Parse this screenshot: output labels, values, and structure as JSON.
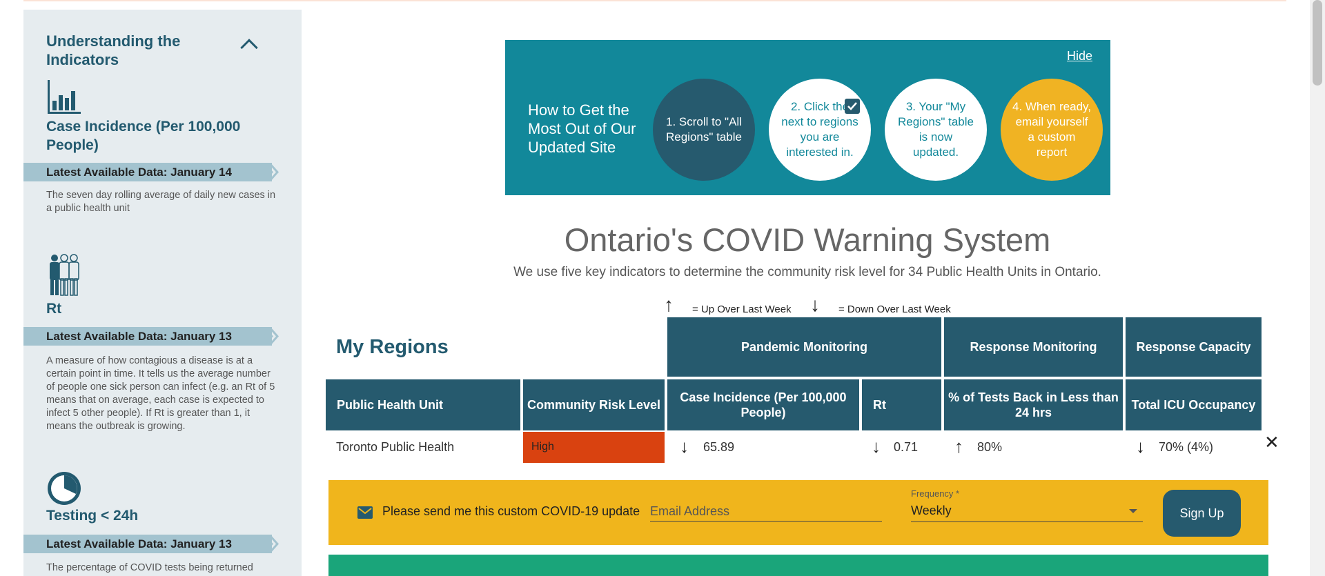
{
  "sidebar": {
    "heading": "Understanding the Indicators",
    "indicators": [
      {
        "title": "Case Incidence (Per 100,000 People)",
        "latest": "Latest Available Data: January 14",
        "description": "The seven day rolling average of daily new cases in a public health unit",
        "icon": "bar-chart-icon"
      },
      {
        "title": "Rt",
        "latest": "Latest Available Data: January 13",
        "description": "A measure of how contagious a disease is at a certain point in time. It tells us the average number of people one sick person can infect (e.g. an Rt of 5 means that on average, each case is expected to infect 5 other people). If Rt is greater than 1, it means the outbreak is growing.",
        "icon": "people-icon"
      },
      {
        "title": "Testing < 24h",
        "latest": "Latest Available Data: January 13",
        "description": "The percentage of COVID tests being returned",
        "icon": "clock-icon"
      }
    ]
  },
  "promo": {
    "hide_label": "Hide",
    "title": "How to Get the Most Out of Our Updated Site",
    "steps": [
      "1. Scroll to \"All Regions\" table",
      "2. Click the next to regions you are interested in.",
      "3. Your \"My Regions\" table is now updated.",
      "4. When ready, email yourself a custom report"
    ]
  },
  "main": {
    "title": "Ontario's COVID Warning System",
    "subtitle": "We use five key indicators to determine the community risk level for 34 Public Health Units in Ontario.",
    "legend_up": "= Up Over Last Week",
    "legend_down": "= Down Over Last Week",
    "up_arrow": "↑",
    "down_arrow": "↓"
  },
  "table": {
    "section_title": "My Regions",
    "groups": [
      "Pandemic Monitoring",
      "Response Monitoring",
      "Response Capacity"
    ],
    "columns": [
      "Public Health Unit",
      "Community Risk Level",
      "Case Incidence (Per 100,000 People)",
      "Rt",
      "% of Tests Back in Less than 24 hrs",
      "Total ICU Occupancy"
    ],
    "rows": [
      {
        "unit": "Toronto Public Health",
        "risk": "High",
        "risk_color": "#d94210",
        "case_arrow": "↓",
        "case_incidence": "65.89",
        "rt_arrow": "↓",
        "rt": "0.71",
        "tests_arrow": "↑",
        "tests": "80%",
        "icu_arrow": "↓",
        "icu": "70% (4%)",
        "remove_label": "✕"
      }
    ]
  },
  "signup": {
    "text": "Please send me this custom COVID-19 update",
    "email_placeholder": "Email Address",
    "frequency_label": "Frequency *",
    "frequency_value": "Weekly",
    "button_label": "Sign Up"
  },
  "colors": {
    "navy": "#265a6e",
    "teal": "#12889a",
    "gold": "#f0b323",
    "risk_high": "#d94210",
    "green": "#1aa57a"
  }
}
